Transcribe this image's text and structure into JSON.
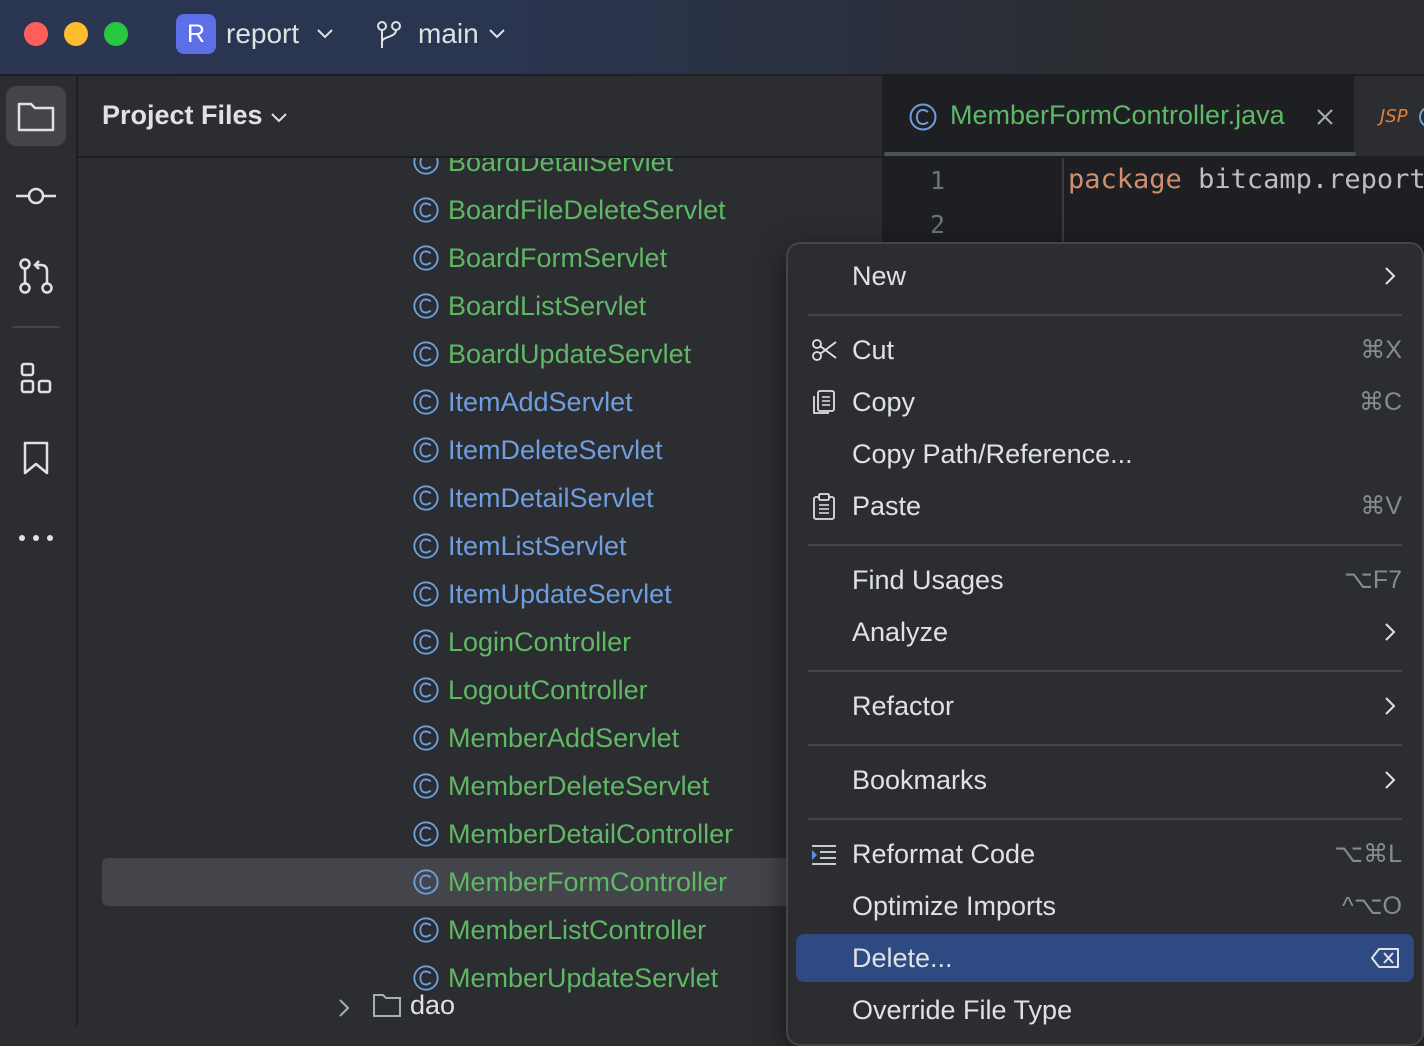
{
  "titlebar": {
    "project_badge": "R",
    "project_name": "report",
    "branch_name": "main",
    "traffic_colors": [
      "#ff5f57",
      "#febc2e",
      "#28c840"
    ]
  },
  "activity_bar": {
    "icons": [
      "folder-icon",
      "commit-icon",
      "pull-request-icon",
      "structure-icon",
      "bookmark-icon",
      "more-icon"
    ]
  },
  "project_panel": {
    "title": "Project Files",
    "items": [
      {
        "label": "BoardDetailServlet",
        "color": "#5fb865"
      },
      {
        "label": "BoardFileDeleteServlet",
        "color": "#5fb865"
      },
      {
        "label": "BoardFormServlet",
        "color": "#5fb865"
      },
      {
        "label": "BoardListServlet",
        "color": "#5fb865"
      },
      {
        "label": "BoardUpdateServlet",
        "color": "#5fb865"
      },
      {
        "label": "ItemAddServlet",
        "color": "#6f9ee0"
      },
      {
        "label": "ItemDeleteServlet",
        "color": "#6f9ee0"
      },
      {
        "label": "ItemDetailServlet",
        "color": "#6f9ee0"
      },
      {
        "label": "ItemListServlet",
        "color": "#6f9ee0"
      },
      {
        "label": "ItemUpdateServlet",
        "color": "#6f9ee0"
      },
      {
        "label": "LoginController",
        "color": "#5fb865"
      },
      {
        "label": "LogoutController",
        "color": "#5fb865"
      },
      {
        "label": "MemberAddServlet",
        "color": "#5fb865"
      },
      {
        "label": "MemberDeleteServlet",
        "color": "#5fb865"
      },
      {
        "label": "MemberDetailController",
        "color": "#5fb865"
      },
      {
        "label": "MemberFormController",
        "color": "#5fb865",
        "selected": true
      },
      {
        "label": "MemberListController",
        "color": "#5fb865"
      },
      {
        "label": "MemberUpdateServlet",
        "color": "#5fb865"
      }
    ],
    "folder": "dao"
  },
  "editor": {
    "active_tab": "MemberFormController.java",
    "next_tab_badge": "JSP",
    "line_numbers": [
      "1",
      "2"
    ],
    "code_keyword": "package",
    "code_rest": "bitcamp.report.c"
  },
  "context_menu": {
    "items": [
      {
        "label": "New",
        "submenu": true
      },
      {
        "sep": true
      },
      {
        "label": "Cut",
        "shortcut": "⌘X",
        "icon": "scissors-icon"
      },
      {
        "label": "Copy",
        "shortcut": "⌘C",
        "icon": "copy-icon"
      },
      {
        "label": "Copy Path/Reference..."
      },
      {
        "label": "Paste",
        "shortcut": "⌘V",
        "icon": "paste-icon"
      },
      {
        "sep": true
      },
      {
        "label": "Find Usages",
        "shortcut": "⌥F7"
      },
      {
        "label": "Analyze",
        "submenu": true
      },
      {
        "sep": true
      },
      {
        "label": "Refactor",
        "submenu": true
      },
      {
        "sep": true
      },
      {
        "label": "Bookmarks",
        "submenu": true
      },
      {
        "sep": true
      },
      {
        "label": "Reformat Code",
        "shortcut": "⌥⌘L",
        "icon": "reformat-icon"
      },
      {
        "label": "Optimize Imports",
        "shortcut": "^⌥O"
      },
      {
        "label": "Delete...",
        "highlighted": true,
        "trailing_icon": "delete-key-icon"
      },
      {
        "label": "Override File Type"
      }
    ]
  },
  "colors": {
    "accent": "#2e4a82",
    "class_icon": "#6f9ee0",
    "keyword": "#cf8e6d"
  }
}
